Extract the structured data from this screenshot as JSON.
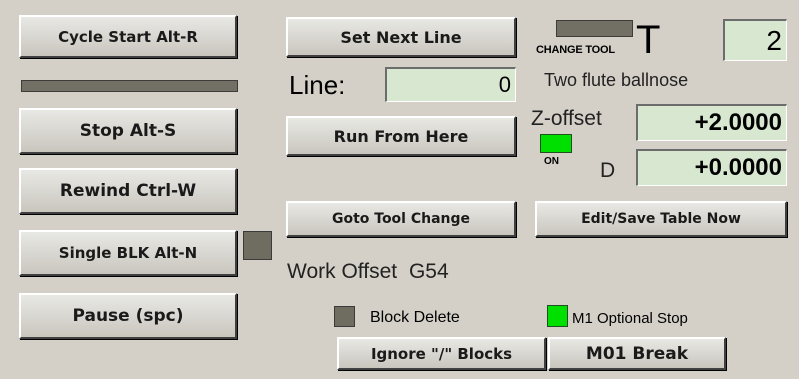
{
  "buttons": {
    "cycle_start": "Cycle Start Alt-R",
    "stop": "Stop Alt-S",
    "rewind": "Rewind Ctrl-W",
    "single_block": "Single BLK Alt-N",
    "pause": "Pause (spc)",
    "set_next_line": "Set Next Line",
    "run_from_here": "Run From Here",
    "goto_tool_change": "Goto Tool Change",
    "edit_save_table": "Edit/Save Table Now",
    "ignore_blocks": "Ignore \"/\" Blocks",
    "m01_break": "M01 Break"
  },
  "line": {
    "label": "Line:",
    "value": "0"
  },
  "tool": {
    "change_tool_label": "CHANGE TOOL",
    "t_label": "T",
    "number": "2",
    "description": "Two flute ballnose",
    "z_offset_label": "Z-offset",
    "z_offset_value": "+2.0000",
    "on_label": "ON",
    "d_label": "D",
    "d_value": "+0.0000"
  },
  "work_offset": {
    "label": "Work Offset",
    "value": "G54"
  },
  "toggles": {
    "block_delete": "Block Delete",
    "m1_optional_stop": "M1 Optional Stop"
  },
  "colors": {
    "background": "#d4d0c8",
    "led_on": "#00e000",
    "led_off": "#6f6c60",
    "field_bg": "#d8e8d0"
  }
}
